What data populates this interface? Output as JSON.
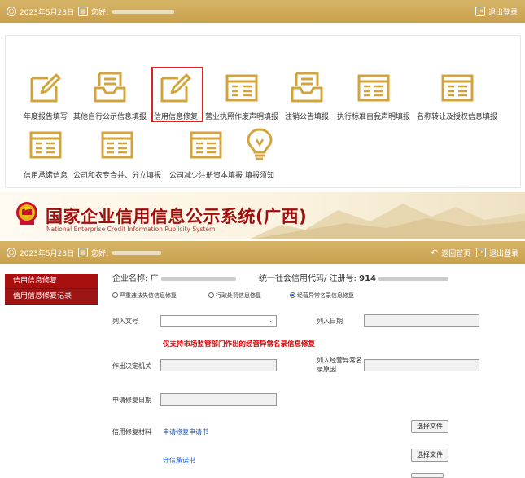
{
  "top_bar": {
    "date": "2023年5月23日",
    "greeting": "您好!",
    "logout": "退出登录"
  },
  "tiles_row1": [
    {
      "label": "年度报告填写",
      "icon": "edit-doc-icon"
    },
    {
      "label": "其他自行公示信息填报",
      "icon": "inbox-tray-icon"
    },
    {
      "label": "信用信息修复",
      "icon": "edit-doc-icon"
    },
    {
      "label": "营业执照作废声明填报",
      "icon": "document-list-icon"
    },
    {
      "label": "注销公告填报",
      "icon": "inbox-tray-icon"
    },
    {
      "label": "执行标准自我声明填报",
      "icon": "document-list-icon"
    },
    {
      "label": "名称转让及授权信息填报",
      "icon": "document-list-icon"
    }
  ],
  "tiles_row2": [
    {
      "label": "信用承诺信息",
      "icon": "document-list-icon"
    },
    {
      "label": "公司和农专合并、分立填报",
      "icon": "document-list-icon"
    },
    {
      "label": "公司减少注册资本填报",
      "icon": "document-list-icon"
    },
    {
      "label": "填报须知",
      "icon": "lightbulb-icon"
    }
  ],
  "banner": {
    "title": "国家企业信用信息公示系统(广西)",
    "subtitle": "National Enterprise Credit Information Publicity System"
  },
  "sub_bar": {
    "date": "2023年5月23日",
    "greeting": "您好!",
    "home": "返回首页",
    "logout": "退出登录"
  },
  "sidebar": {
    "items": [
      {
        "label": "信用信息修复"
      },
      {
        "label": "信用信息修复记录"
      }
    ]
  },
  "form": {
    "company_label": "企业名称:",
    "company_value": "广",
    "credit_code_label": "统一社会信用代码/ 注册号:",
    "credit_code_value": "914",
    "radios": [
      {
        "label": "严重违法失信信息修复",
        "checked": false
      },
      {
        "label": "行政处罚信息修复",
        "checked": false
      },
      {
        "label": "经营异常名录信息修复",
        "checked": true
      }
    ],
    "doc_no_label": "列入文号",
    "list_date_label": "列入日期",
    "notice": "仅支持市场监管部门作出的经营异常名录信息修复",
    "authority_label": "作出决定机关",
    "reason_label_1": "列入经营异常名",
    "reason_label_2": "录原因",
    "apply_date_label": "申请修复日期",
    "materials_label": "信用修复材料",
    "application_link": "申请修复申请书",
    "promise_link": "守信承诺书",
    "choose_file_1": "选择文件",
    "choose_file_2": "选择文件"
  },
  "colors": {
    "gold_bar": "#c9a14e",
    "brand_red": "#a00d0d",
    "highlight_red": "#e02020",
    "link_blue": "#1a5ad6"
  }
}
